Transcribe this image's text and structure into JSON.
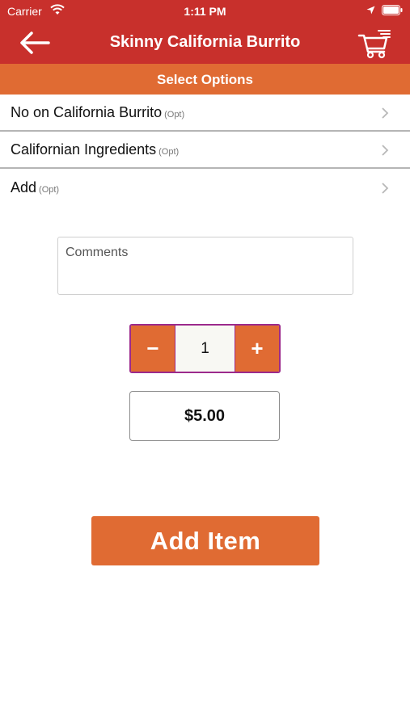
{
  "status_bar": {
    "carrier": "Carrier",
    "time": "1:11 PM",
    "icons": [
      "wifi-icon",
      "location-icon",
      "battery-icon"
    ]
  },
  "nav": {
    "title": "Skinny California Burrito",
    "back_icon": "arrow-left-icon",
    "cart_icon": "cart-icon"
  },
  "section_header": "Select Options",
  "options": [
    {
      "label": "No on California Burrito",
      "tag": "(Opt)"
    },
    {
      "label": "Californian Ingredients",
      "tag": "(Opt)"
    },
    {
      "label": "Add",
      "tag": "(Opt)"
    }
  ],
  "comments": {
    "placeholder": "Comments",
    "value": ""
  },
  "quantity": {
    "minus": "−",
    "value": "1",
    "plus": "+"
  },
  "price": "$5.00",
  "add_button": "Add Item",
  "colors": {
    "header_red": "#c8302c",
    "accent_orange": "#e06b33",
    "stepper_border": "#9c2a8c"
  }
}
